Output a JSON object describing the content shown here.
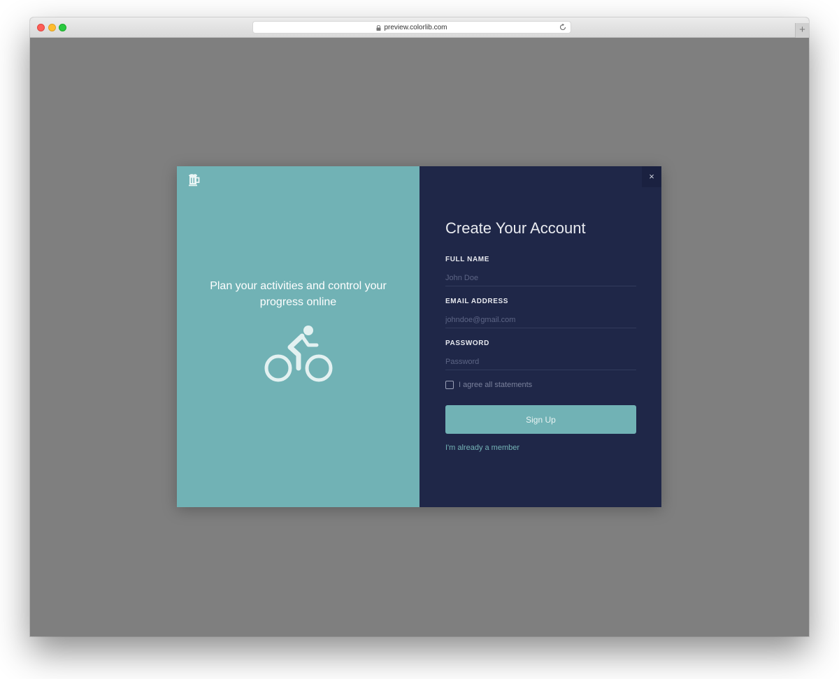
{
  "browser": {
    "url": "preview.colorlib.com",
    "new_tab_label": "+"
  },
  "modal": {
    "left": {
      "tagline": "Plan your activities and control your progress online"
    },
    "form": {
      "title": "Create Your Account",
      "close_label": "×",
      "fields": [
        {
          "label": "FULL NAME",
          "placeholder": "John Doe"
        },
        {
          "label": "EMAIL ADDRESS",
          "placeholder": "johndoe@gmail.com"
        },
        {
          "label": "PASSWORD",
          "placeholder": "Password"
        }
      ],
      "agree_label": "I agree all statements",
      "signup_label": "Sign Up",
      "member_link": "I'm already a member"
    }
  },
  "icons": [
    "lock-icon",
    "reload-icon",
    "beer-mug-icon",
    "bicycle-icon",
    "close-icon"
  ],
  "colors": {
    "accent": "#71b2b5",
    "form_bg": "#1f2748",
    "overlay": "#7f7f7f"
  }
}
